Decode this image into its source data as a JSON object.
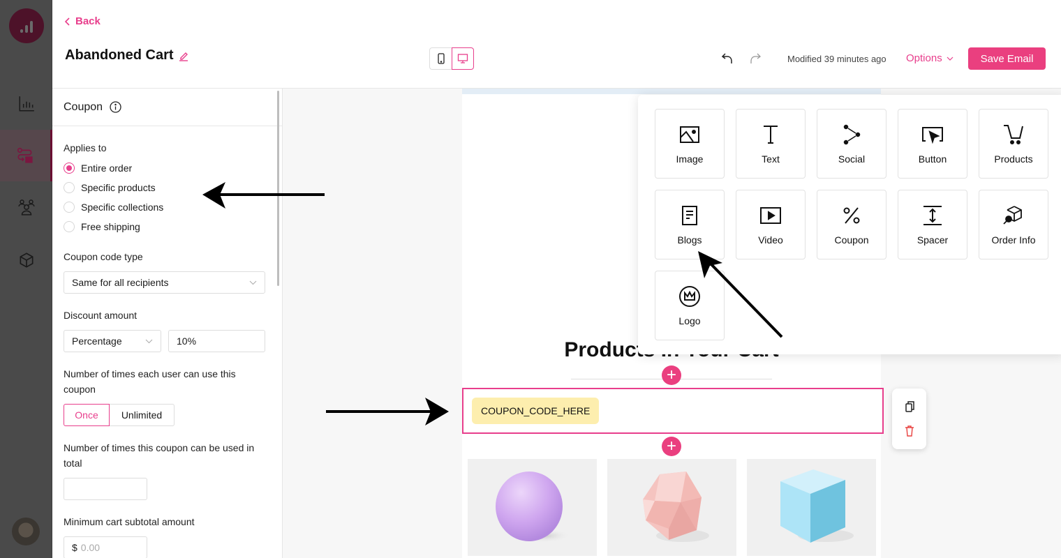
{
  "rail": {
    "items": [
      {
        "name": "analytics",
        "icon": "bar-chart-icon",
        "active": false
      },
      {
        "name": "flows",
        "icon": "flow-icon",
        "active": true
      },
      {
        "name": "audience",
        "icon": "users-icon",
        "active": false
      },
      {
        "name": "integrations",
        "icon": "box-icon",
        "active": false
      }
    ]
  },
  "header": {
    "back_label": "Back",
    "title": "Abandoned Cart",
    "modified": "Modified 39 minutes ago",
    "options_label": "Options",
    "save_label": "Save Email",
    "device_active": "desktop"
  },
  "panel": {
    "title": "Coupon",
    "applies_to": {
      "label": "Applies to",
      "options": [
        "Entire order",
        "Specific products",
        "Specific collections",
        "Free shipping"
      ],
      "selected": "Entire order"
    },
    "code_type": {
      "label": "Coupon code type",
      "value": "Same for all recipients"
    },
    "discount": {
      "label": "Discount amount",
      "type": "Percentage",
      "value": "10%"
    },
    "per_user": {
      "label": "Number of times each user can use this coupon",
      "options": [
        "Once",
        "Unlimited"
      ],
      "selected": "Once"
    },
    "total_uses": {
      "label": "Number of times this coupon can be used in total",
      "value": ""
    },
    "min_subtotal": {
      "label": "Minimum cart subtotal amount",
      "prefix": "$",
      "placeholder": "0.00"
    }
  },
  "picker": {
    "tiles": [
      {
        "label": "Image",
        "icon": "image-icon"
      },
      {
        "label": "Text",
        "icon": "text-icon"
      },
      {
        "label": "Social",
        "icon": "social-icon"
      },
      {
        "label": "Button",
        "icon": "button-icon"
      },
      {
        "label": "Products",
        "icon": "cart-icon"
      },
      {
        "label": "Blogs",
        "icon": "blog-icon"
      },
      {
        "label": "Video",
        "icon": "video-icon"
      },
      {
        "label": "Coupon",
        "icon": "percent-icon"
      },
      {
        "label": "Spacer",
        "icon": "spacer-icon"
      },
      {
        "label": "Order Info",
        "icon": "order-info-icon"
      },
      {
        "label": "Logo",
        "icon": "crown-icon"
      }
    ]
  },
  "email": {
    "heading": "Products In Your Cart",
    "coupon_code": "COUPON_CODE_HERE",
    "products": [
      {
        "shape": "sphere",
        "color": "#c9a0ec"
      },
      {
        "shape": "icosahedron",
        "color": "#f2b8b4"
      },
      {
        "shape": "cube",
        "color": "#a6dcf0"
      }
    ]
  },
  "colors": {
    "accent": "#e83e8c",
    "coupon_chip": "#fdeeae"
  }
}
